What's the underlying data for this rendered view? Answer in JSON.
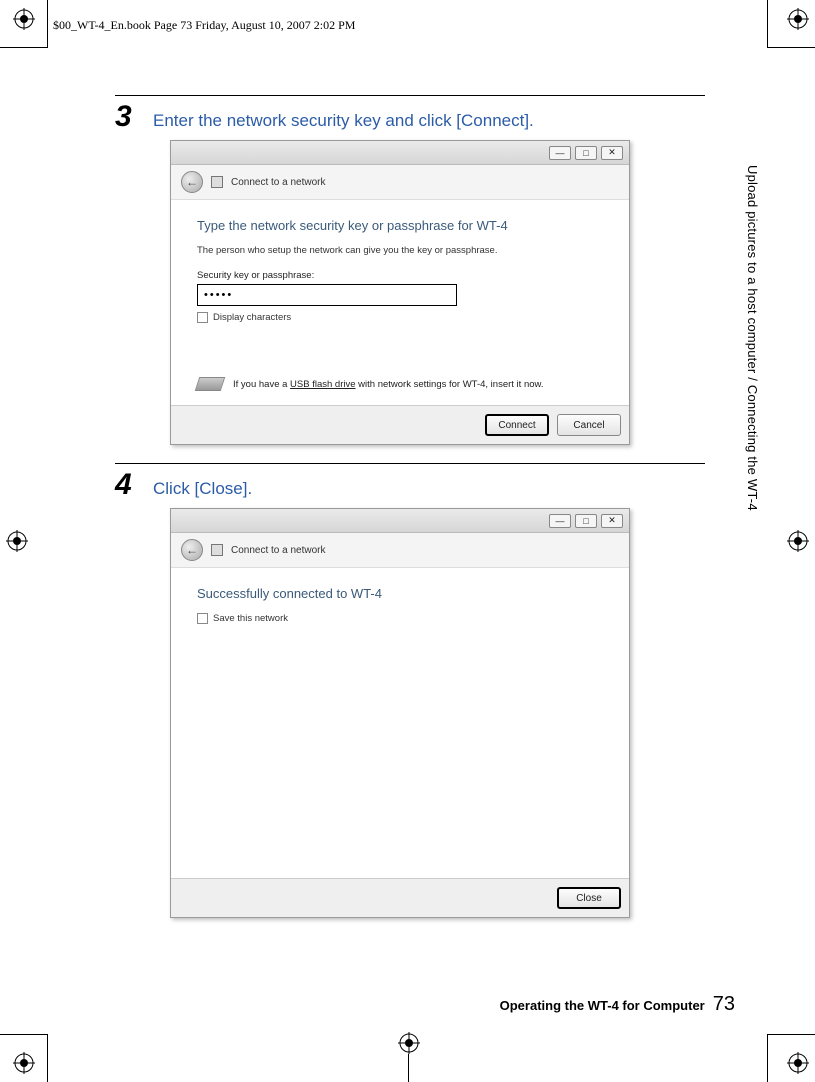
{
  "header": "$00_WT-4_En.book  Page 73  Friday, August 10, 2007  2:02 PM",
  "side_text": "Upload pictures to a host computer / Connecting the WT-4",
  "step3": {
    "num": "3",
    "text": "Enter the network security key and click [Connect].",
    "window_sub_title": "Connect to a network",
    "heading": "Type the network security key or passphrase for WT-4",
    "subtext": "The person who setup the network can give you the key or passphrase.",
    "label": "Security key or passphrase:",
    "input_value": "•••••",
    "checkbox_label": "Display characters",
    "usb_text_a": "If you have a ",
    "usb_text_link": "USB flash drive",
    "usb_text_b": " with network settings for WT-4, insert it now.",
    "btn_connect": "Connect",
    "btn_cancel": "Cancel"
  },
  "step4": {
    "num": "4",
    "text": "Click [Close].",
    "window_sub_title": "Connect to a network",
    "heading": "Successfully connected to WT-4",
    "checkbox_label": "Save this network",
    "btn_close": "Close"
  },
  "footer": {
    "text": "Operating the WT-4 for Computer",
    "page": "73"
  },
  "tb": {
    "min": "—",
    "max": "□",
    "close": "✕"
  }
}
